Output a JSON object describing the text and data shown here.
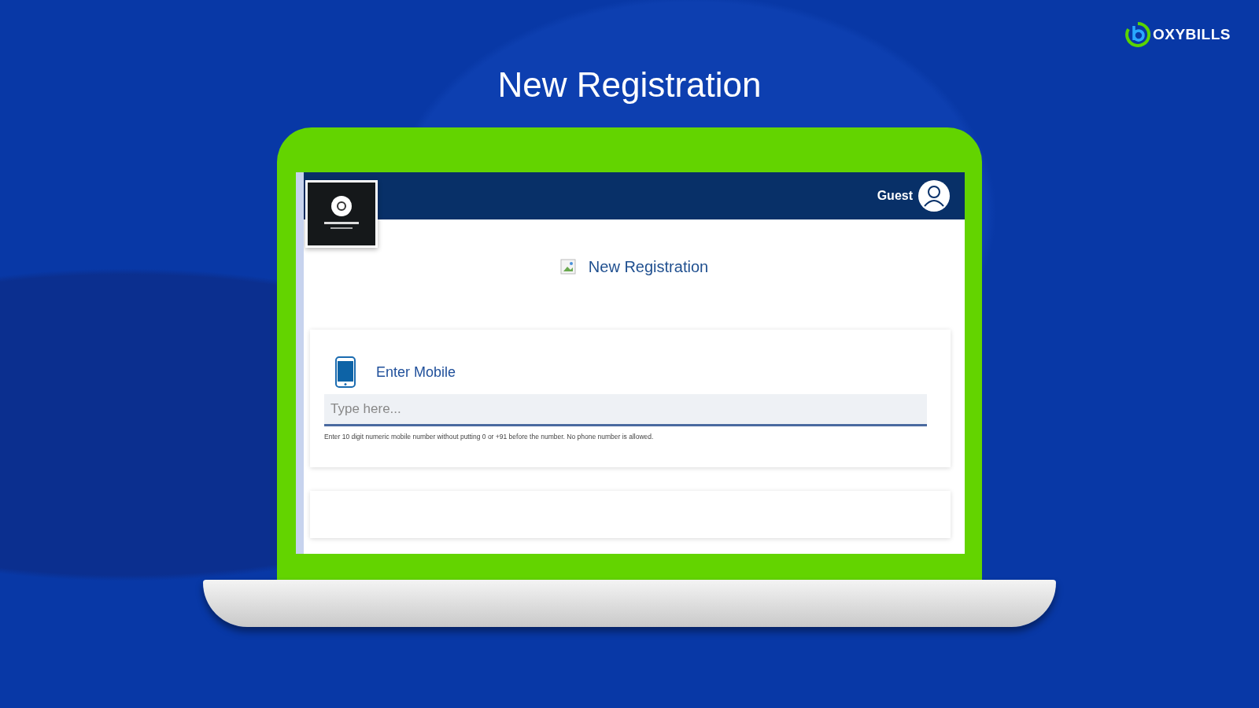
{
  "brand": {
    "name": "OXYBILLS"
  },
  "slide_title": "New Registration",
  "app": {
    "user": {
      "name": "Guest"
    },
    "page_title": "New Registration",
    "form": {
      "label": "Enter Mobile",
      "placeholder": "Type here...",
      "hint": "Enter 10 digit numeric mobile number without putting 0 or +91 before the number. No phone number is allowed."
    }
  }
}
